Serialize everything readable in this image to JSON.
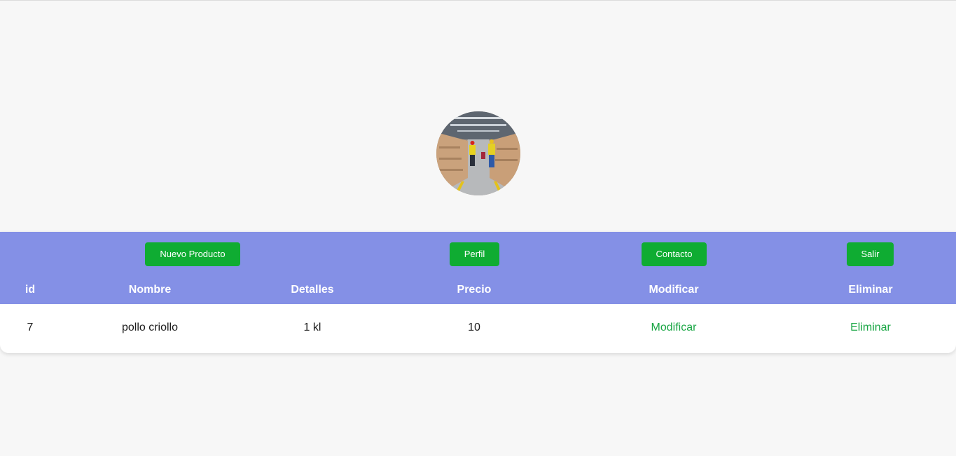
{
  "nav": {
    "new_product_label": "Nuevo Producto",
    "profile_label": "Perfil",
    "contact_label": "Contacto",
    "logout_label": "Salir"
  },
  "table": {
    "columns": [
      "id",
      "Nombre",
      "Detalles",
      "Precio",
      "Modificar",
      "Eliminar"
    ],
    "rows": [
      {
        "id": "7",
        "nombre": "pollo criollo",
        "detalles": "1 kl",
        "precio": "10",
        "modificar": "Modificar",
        "eliminar": "Eliminar"
      }
    ]
  },
  "colors": {
    "header_bg": "#8490e6",
    "button_bg": "#0fac32",
    "link": "#19a644",
    "page_bg": "#f7f7f7"
  }
}
